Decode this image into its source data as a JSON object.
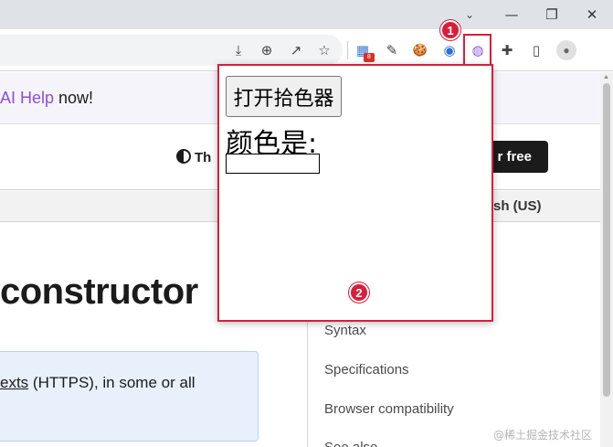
{
  "browser": {
    "window_controls": {
      "tab_search": "⌄",
      "minimize": "—",
      "restore": "❐",
      "close": "✕"
    },
    "toolbar_icons": {
      "install": "⤓",
      "zoom": "⊕",
      "share": "↗",
      "bookmark": "☆",
      "ext_tiles": "▦",
      "ext_eyedropper": "✎",
      "ext_cookie": "🍪",
      "ext_globe": "◉",
      "ext_colorpicker": "◍",
      "extensions_puzzle": "✚",
      "side_panel": "▯",
      "profile": "●"
    },
    "ext_badge": "8"
  },
  "page": {
    "banner": {
      "link": "AI Help",
      "suffix": " now!"
    },
    "theme_label": "Th",
    "signup_label": "r free",
    "language": "sh (US)",
    "heading": "constructor",
    "note": {
      "link": "exts",
      "text": " (HTTPS), in some or all"
    },
    "toc": [
      "Syntax",
      "Specifications",
      "Browser compatibility",
      "See also"
    ]
  },
  "popup": {
    "pick_button": "打开拾色器",
    "label": "颜色是:",
    "input_value": ""
  },
  "annotations": {
    "callout_1": "1",
    "callout_2": "2"
  },
  "watermark": "@稀土掘金技术社区",
  "colors": {
    "highlight": "#d81e3a",
    "link_purple": "#8a4fdc",
    "note_bg": "#e8f0fc"
  }
}
